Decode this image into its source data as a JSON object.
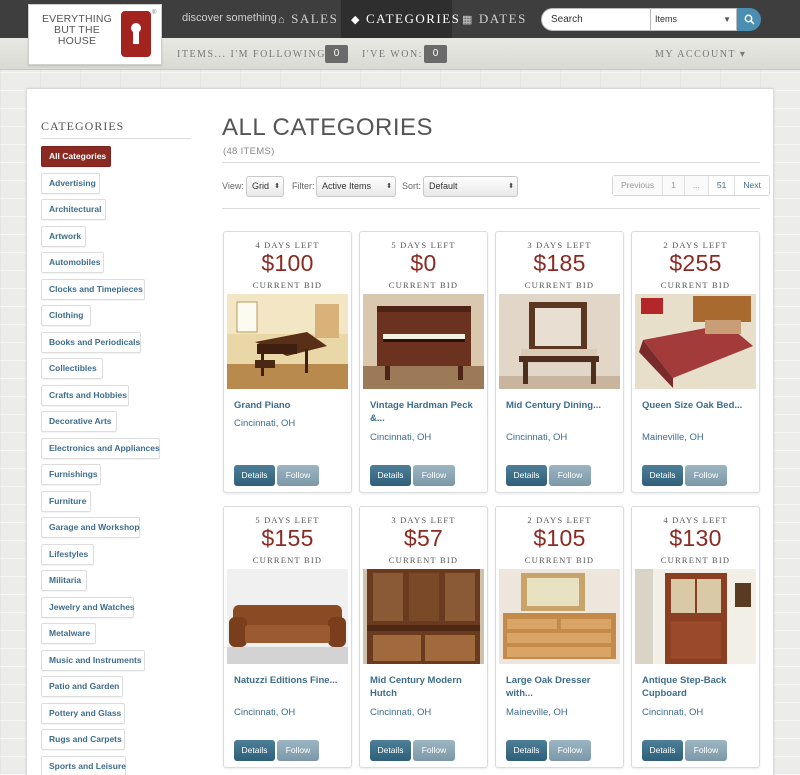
{
  "brand": {
    "logo_text": "EVERYTHING BUT THE HOUSE",
    "reg_mark": "®"
  },
  "nav": {
    "discover": "discover something",
    "sales": "SALES",
    "categories": "CATEGORIES",
    "dates": "DATES"
  },
  "search": {
    "value": "Search",
    "scope": "Items"
  },
  "subnav": {
    "following_label": "ITEMS... I'M FOLLOWING:",
    "following_count": "0",
    "won_label": "I'VE WON:",
    "won_count": "0",
    "account": "MY ACCOUNT ▾"
  },
  "sidebar": {
    "title": "CATEGORIES",
    "items": [
      {
        "label": "All Categories",
        "active": true
      },
      {
        "label": "Advertising"
      },
      {
        "label": "Architectural"
      },
      {
        "label": "Artwork"
      },
      {
        "label": "Automobiles"
      },
      {
        "label": "Clocks and Timepieces"
      },
      {
        "label": "Clothing"
      },
      {
        "label": "Books and Periodicals"
      },
      {
        "label": "Collectibles"
      },
      {
        "label": "Crafts and Hobbies"
      },
      {
        "label": "Decorative Arts"
      },
      {
        "label": "Electronics and Appliances"
      },
      {
        "label": "Furnishings"
      },
      {
        "label": "Furniture"
      },
      {
        "label": "Garage and Workshop"
      },
      {
        "label": "Lifestyles"
      },
      {
        "label": "Militaria"
      },
      {
        "label": "Jewelry and Watches"
      },
      {
        "label": "Metalware"
      },
      {
        "label": "Music and Instruments"
      },
      {
        "label": "Patio and Garden"
      },
      {
        "label": "Pottery and Glass"
      },
      {
        "label": "Rugs and Carpets"
      },
      {
        "label": "Sports and Leisure"
      }
    ]
  },
  "main": {
    "title": "ALL CATEGORIES",
    "count": "(48 ITEMS)",
    "view_label": "View:",
    "view_value": "Grid",
    "filter_label": "Filter:",
    "filter_value": "Active Items",
    "sort_label": "Sort:",
    "sort_value": "Default",
    "pager": [
      "Previous",
      "1",
      "...",
      "51",
      "Next"
    ]
  },
  "cards": [
    {
      "days": "4 DAYS LEFT",
      "price": "$100",
      "bid_label": "CURRENT BID",
      "name": "Grand Piano",
      "location": "Cincinnati, OH",
      "details": "Details",
      "follow": "Follow",
      "image": "grand-piano"
    },
    {
      "days": "5 DAYS LEFT",
      "price": "$0",
      "bid_label": "CURRENT BID",
      "name": "Vintage Hardman Peck &...",
      "location": "Cincinnati, OH",
      "details": "Details",
      "follow": "Follow",
      "image": "upright-piano"
    },
    {
      "days": "3 DAYS LEFT",
      "price": "$185",
      "bid_label": "CURRENT BID",
      "name": "Mid Century Dining...",
      "location": "Cincinnati, OH",
      "details": "Details",
      "follow": "Follow",
      "image": "dining-chair"
    },
    {
      "days": "2 DAYS LEFT",
      "price": "$255",
      "bid_label": "CURRENT BID",
      "name": "Queen Size Oak Bed...",
      "location": "Maineville, OH",
      "details": "Details",
      "follow": "Follow",
      "image": "oak-bed"
    },
    {
      "days": "5 DAYS LEFT",
      "price": "$155",
      "bid_label": "CURRENT BID",
      "name": "Natuzzi Editions Fine...",
      "location": "Cincinnati, OH",
      "details": "Details",
      "follow": "Follow",
      "image": "leather-sofa"
    },
    {
      "days": "3 DAYS LEFT",
      "price": "$57",
      "bid_label": "CURRENT BID",
      "name": "Mid Century Modern Hutch",
      "location": "Cincinnati, OH",
      "details": "Details",
      "follow": "Follow",
      "image": "hutch"
    },
    {
      "days": "2 DAYS LEFT",
      "price": "$105",
      "bid_label": "CURRENT BID",
      "name": "Large Oak Dresser with...",
      "location": "Maineville, OH",
      "details": "Details",
      "follow": "Follow",
      "image": "oak-dresser"
    },
    {
      "days": "4 DAYS LEFT",
      "price": "$130",
      "bid_label": "CURRENT BID",
      "name": "Antique Step-Back Cupboard",
      "location": "Cincinnati, OH",
      "details": "Details",
      "follow": "Follow",
      "image": "cupboard"
    }
  ]
}
